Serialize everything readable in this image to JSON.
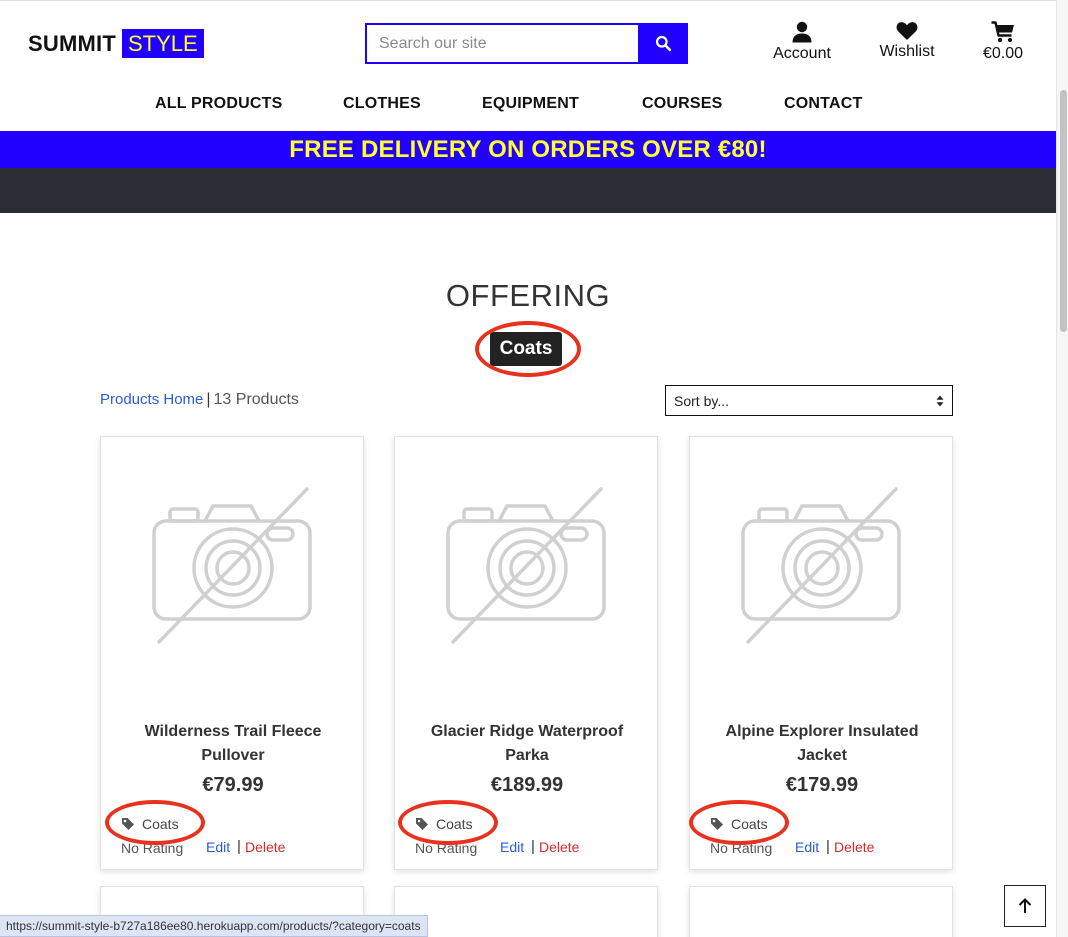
{
  "header": {
    "logo_word1": "SUMMIT",
    "logo_word2": "STYLE",
    "search_placeholder": "Search our site",
    "account_label": "Account",
    "wishlist_label": "Wishlist",
    "cart_total": "€0.00"
  },
  "nav": {
    "items": [
      {
        "label": "ALL PRODUCTS"
      },
      {
        "label": "CLOTHES"
      },
      {
        "label": "EQUIPMENT"
      },
      {
        "label": "COURSES"
      },
      {
        "label": "CONTACT"
      }
    ]
  },
  "banner": {
    "text": "FREE DELIVERY ON ORDERS OVER €80!"
  },
  "main": {
    "heading": "OFFERING",
    "category_badge": "Coats",
    "products_home_link": "Products Home",
    "separator": "|",
    "product_count": "13 Products",
    "sort_selected": "Sort by..."
  },
  "products": [
    {
      "name": "Wilderness Trail Fleece Pullover",
      "price": "€79.99",
      "category": "Coats",
      "rating": "No Rating",
      "edit": "Edit",
      "delete": "Delete"
    },
    {
      "name": "Glacier Ridge Waterproof Parka",
      "price": "€189.99",
      "category": "Coats",
      "rating": "No Rating",
      "edit": "Edit",
      "delete": "Delete"
    },
    {
      "name": "Alpine Explorer Insulated Jacket",
      "price": "€179.99",
      "category": "Coats",
      "rating": "No Rating",
      "edit": "Edit",
      "delete": "Delete"
    }
  ],
  "status_bar": {
    "url": "https://summit-style-b727a186ee80.herokuapp.com/products/?category=coats"
  },
  "colors": {
    "brand_blue": "#2200ff",
    "brand_yellow": "#ffff33",
    "dark_bar": "#2a2d36",
    "annotation_red": "#e8321e",
    "link_blue": "#2a5bd7",
    "delete_red": "#d62b2b"
  },
  "icons": {
    "search": "search-icon",
    "account": "user-icon",
    "wishlist": "heart-icon",
    "cart": "cart-icon",
    "tag": "tag-icon",
    "no_image": "no-image-camera-icon",
    "back_to_top": "arrow-up-icon"
  }
}
